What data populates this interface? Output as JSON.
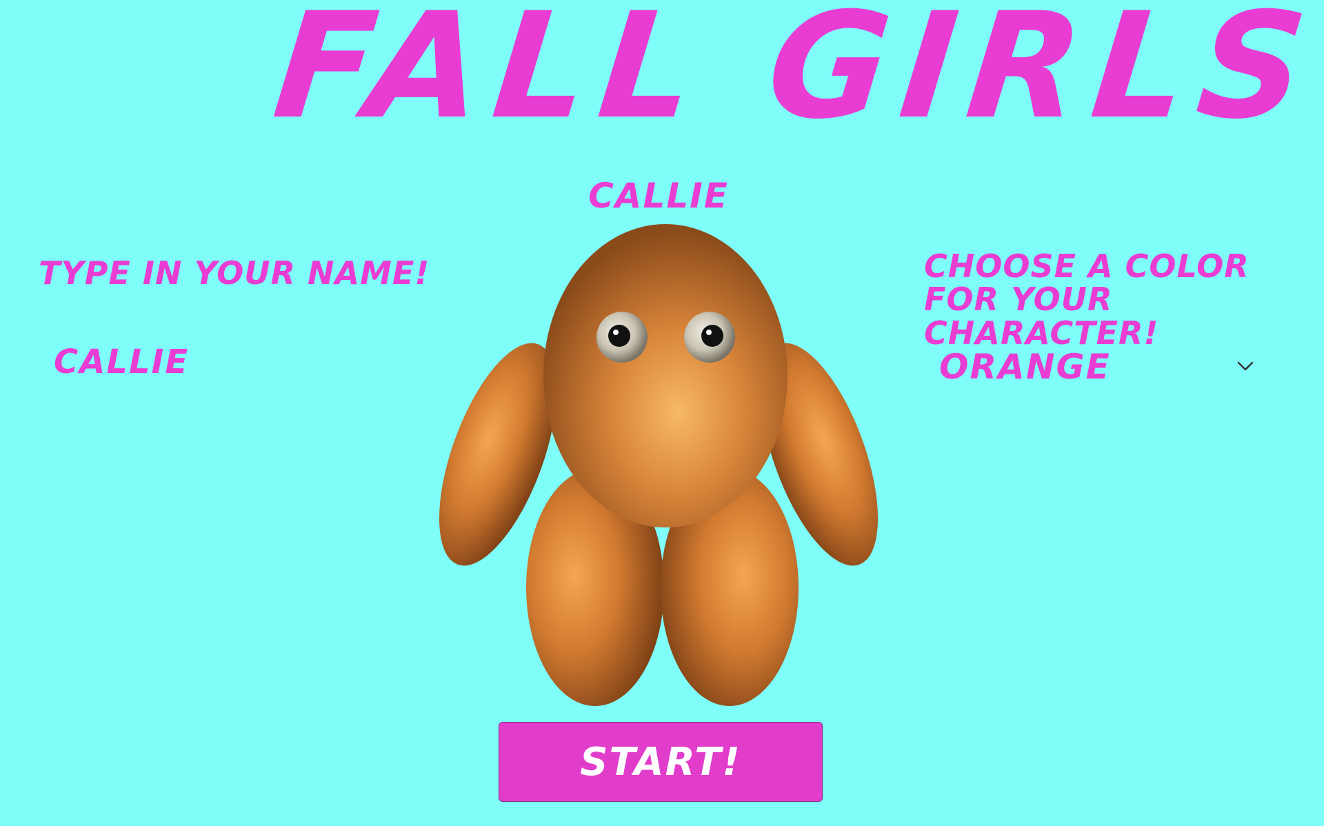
{
  "game": {
    "title": "FALL GIRLS",
    "character_name": "CALLIE"
  },
  "name_section": {
    "label": "TYPE IN YOUR NAME!",
    "input_value": "CALLIE"
  },
  "color_section": {
    "label": "CHOOSE A COLOR FOR YOUR CHARACTER!",
    "selected_value": "ORANGE",
    "dropdown_icon": "chevron-down-icon"
  },
  "start_button": {
    "label": "START!"
  },
  "colors": {
    "background": "#7ffdf9",
    "accent": "#e93cd2",
    "button": "#e23ccb",
    "character_body": "#d8893a"
  }
}
